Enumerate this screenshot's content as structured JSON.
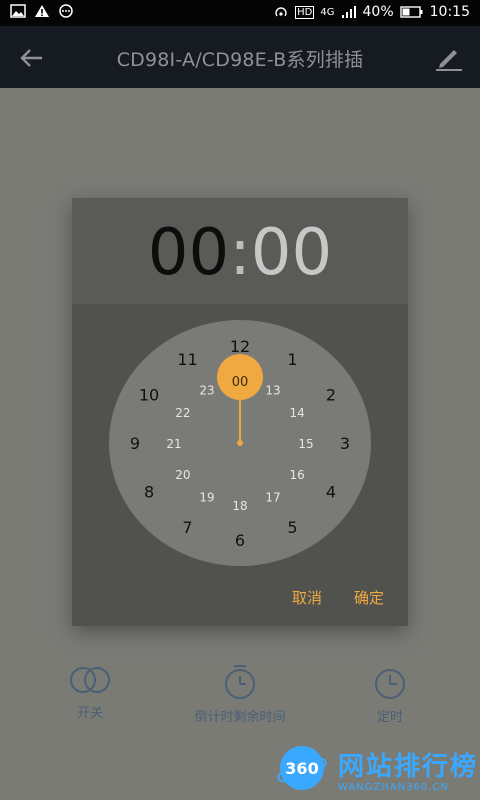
{
  "status_bar": {
    "battery": "40%",
    "time": "10:15",
    "network": "4G"
  },
  "app_bar": {
    "title": "CD98I-A/CD98E-B系列排插"
  },
  "dialog": {
    "hours": "00",
    "separator": ":",
    "minutes": "00",
    "selected_hour": "00",
    "outer_hours": [
      "12",
      "1",
      "2",
      "3",
      "4",
      "5",
      "6",
      "7",
      "8",
      "9",
      "10",
      "11"
    ],
    "inner_hours": [
      "00",
      "13",
      "14",
      "15",
      "16",
      "17",
      "18",
      "19",
      "20",
      "21",
      "22",
      "23"
    ],
    "cancel_label": "取消",
    "ok_label": "确定"
  },
  "tabs": [
    {
      "label": "开关",
      "icon": "switch-icon"
    },
    {
      "label": "倒计时剩余时间",
      "icon": "timer-icon"
    },
    {
      "label": "定时",
      "icon": "clock-icon"
    }
  ],
  "watermark": {
    "logo_text": "360",
    "text": "网站排行榜",
    "sub": "WANGZHAN360.CN"
  },
  "colors": {
    "accent": "#f0a840",
    "app_bar": "#161b22",
    "tab_icon": "#4a5f75"
  }
}
